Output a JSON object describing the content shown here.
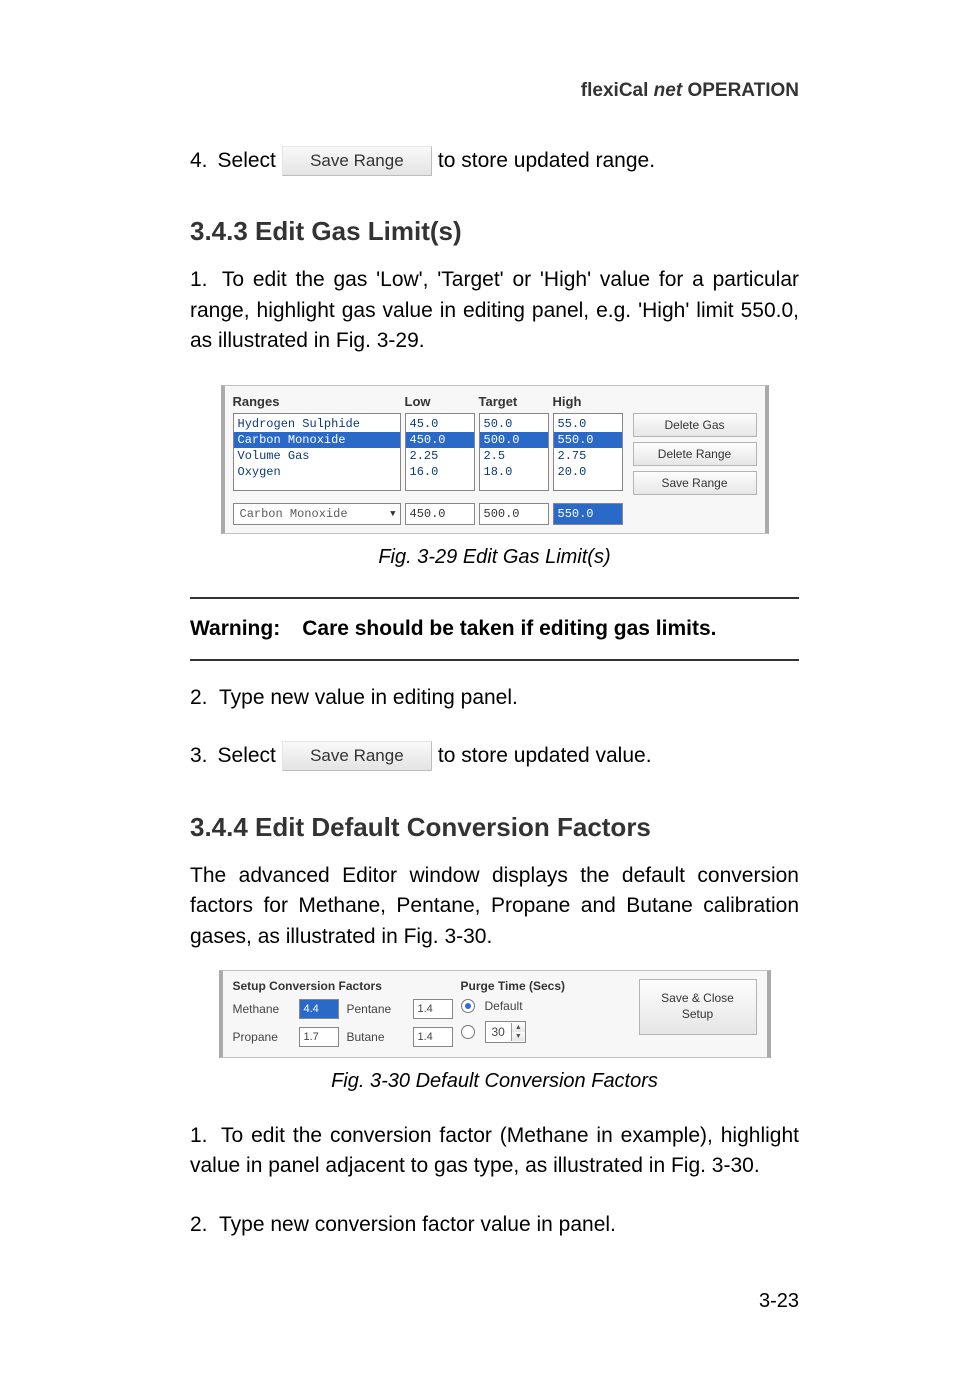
{
  "header": {
    "brand": "flexiCal",
    "brand_italic": "net",
    "section": "OPERATION"
  },
  "step4": {
    "num": "4.",
    "pre": "Select",
    "btn": "Save Range",
    "post": "to store updated range."
  },
  "sec343": {
    "title": "3.4.3  Edit Gas Limit(s)",
    "step1": {
      "num": "1.",
      "text": "To edit the gas 'Low', 'Target' or 'High' value for a particular range, highlight gas value in editing panel, e.g. 'High' limit 550.0, as illustrated in Fig. 3-29."
    },
    "fig_caption": "Fig. 3-29  Edit Gas Limit(s)",
    "warning_label": "Warning:",
    "warning_text": "Care should be taken if editing gas limits.",
    "step2": {
      "num": "2.",
      "text": "Type new value in editing panel."
    },
    "step3": {
      "num": "3.",
      "pre": "Select",
      "btn": "Save Range",
      "post": "to store updated value."
    }
  },
  "fig329": {
    "headers": {
      "ranges": "Ranges",
      "low": "Low",
      "target": "Target",
      "high": "High"
    },
    "rows": [
      {
        "name": "Hydrogen Sulphide",
        "low": "45.0",
        "target": "50.0",
        "high": "55.0"
      },
      {
        "name": "Carbon Monoxide",
        "low": "450.0",
        "target": "500.0",
        "high": "550.0"
      },
      {
        "name": "Volume Gas",
        "low": "2.25",
        "target": "2.5",
        "high": "2.75"
      },
      {
        "name": "Oxygen",
        "low": "16.0",
        "target": "18.0",
        "high": "20.0"
      }
    ],
    "buttons": {
      "delete_gas": "Delete Gas",
      "delete_range": "Delete Range",
      "save_range": "Save Range"
    },
    "edit": {
      "gas": "Carbon Monoxide",
      "low": "450.0",
      "target": "500.0",
      "high": "550.0"
    }
  },
  "sec344": {
    "title": "3.4.4  Edit Default Conversion Factors",
    "intro": "The advanced Editor window displays the default conversion factors for Methane, Pentane, Propane and Butane calibration gases, as illustrated in Fig. 3-30.",
    "fig_caption": "Fig. 3-30  Default Conversion Factors",
    "step1": {
      "num": "1.",
      "text": "To edit the conversion factor (Methane in example), highlight value in panel adjacent to gas type, as illustrated in Fig. 3-30."
    },
    "step2": {
      "num": "2.",
      "text": "Type new conversion factor value in panel."
    }
  },
  "fig330": {
    "factors_title": "Setup Conversion Factors",
    "purge_title": "Purge Time (Secs)",
    "factors": {
      "methane_label": "Methane",
      "methane": "4.4",
      "pentane_label": "Pentane",
      "pentane": "1.4",
      "propane_label": "Propane",
      "propane": "1.7",
      "butane_label": "Butane",
      "butane": "1.4"
    },
    "purge": {
      "default_label": "Default",
      "custom_value": "30"
    },
    "button": {
      "line1": "Save & Close",
      "line2": "Setup"
    }
  },
  "page_number": "3-23"
}
